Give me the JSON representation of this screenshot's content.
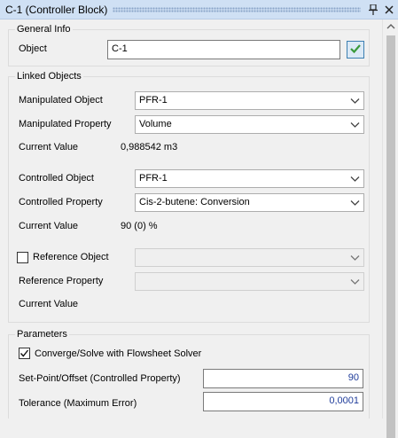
{
  "window": {
    "title": "C-1 (Controller Block)",
    "pin_icon": "pin-icon",
    "close_icon": "close-icon"
  },
  "general_info": {
    "header": "General Info",
    "object_label": "Object",
    "object_value": "C-1",
    "confirm_icon": "checkmark-icon"
  },
  "linked_objects": {
    "header": "Linked Objects",
    "manipulated_object_label": "Manipulated Object",
    "manipulated_object_value": "PFR-1",
    "manipulated_property_label": "Manipulated Property",
    "manipulated_property_value": "Volume",
    "current_value_label_1": "Current Value",
    "current_value_1": "0,988542 m3",
    "controlled_object_label": "Controlled Object",
    "controlled_object_value": "PFR-1",
    "controlled_property_label": "Controlled Property",
    "controlled_property_value": "Cis-2-butene: Conversion",
    "current_value_label_2": "Current Value",
    "current_value_2": "90 (0) %",
    "reference_object_label": "Reference Object",
    "reference_object_checked": false,
    "reference_object_value": "",
    "reference_property_label": "Reference Property",
    "reference_property_value": "",
    "current_value_label_3": "Current Value"
  },
  "parameters": {
    "header": "Parameters",
    "converge_label": "Converge/Solve with Flowsheet Solver",
    "converge_checked": true,
    "setpoint_label": "Set-Point/Offset (Controlled Property)",
    "setpoint_value": "90",
    "tolerance_label": "Tolerance (Maximum Error)",
    "tolerance_value": "0,0001"
  },
  "colors": {
    "titlebar": "#cfe0f4",
    "numeric_text": "#1f3c9a",
    "confirm_green": "#3a9a3a"
  }
}
